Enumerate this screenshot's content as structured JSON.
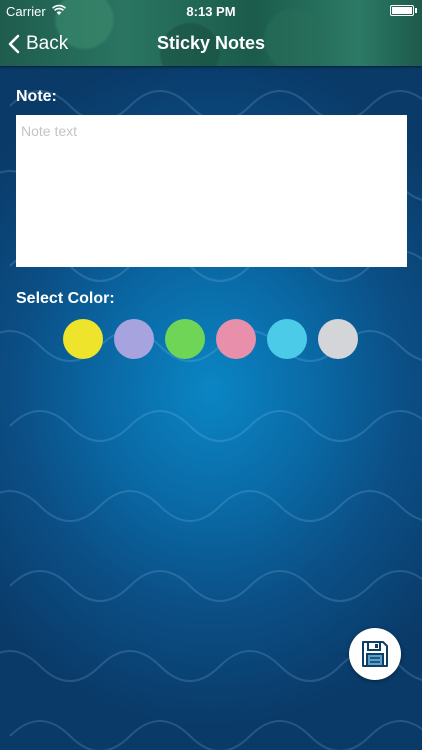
{
  "status_bar": {
    "carrier": "Carrier",
    "time": "8:13 PM",
    "wifi_icon": "wifi-icon",
    "battery_icon": "battery-icon"
  },
  "nav": {
    "back_label": "Back",
    "back_icon": "chevron-left-icon",
    "title": "Sticky Notes"
  },
  "form": {
    "note_label": "Note:",
    "note_value": "",
    "note_placeholder": "Note text",
    "color_label": "Select Color:",
    "colors": [
      {
        "name": "yellow",
        "hex": "#ede42b"
      },
      {
        "name": "lavender",
        "hex": "#a7a3df"
      },
      {
        "name": "green",
        "hex": "#6fd556"
      },
      {
        "name": "pink",
        "hex": "#e890ab"
      },
      {
        "name": "sky-blue",
        "hex": "#4ccbe9"
      },
      {
        "name": "light-gray",
        "hex": "#d3d5d8"
      }
    ]
  },
  "save_button": {
    "icon": "floppy-disk-icon"
  },
  "theme": {
    "header_green": "#1e5c4e",
    "background_blue": "#0a6aa6",
    "text_color": "#ffffff"
  }
}
